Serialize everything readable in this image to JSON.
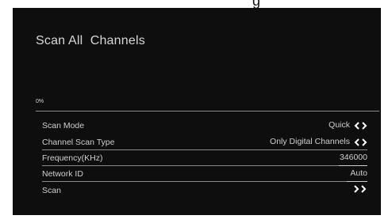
{
  "screen": {
    "title": "Scan All  Channels",
    "progress": {
      "percent_label": "0%",
      "percent_value": 0
    }
  },
  "settings": [
    {
      "label": "Scan Mode",
      "value": "Quick",
      "control": "left-right-arrows-icon"
    },
    {
      "label": "Channel Scan Type",
      "value": "Only Digital Channels",
      "control": "left-right-arrows-icon"
    },
    {
      "label": "Frequency(KHz)",
      "value": "346000",
      "control": "input"
    },
    {
      "label": "Network ID",
      "value": "Auto",
      "control": "input"
    },
    {
      "label": "Scan",
      "value": "",
      "control": "double-right-arrow-icon"
    }
  ],
  "colors": {
    "panel_background": "#0e0e0e",
    "text": "#d8d8d8",
    "divider": "#8a8a8a"
  }
}
